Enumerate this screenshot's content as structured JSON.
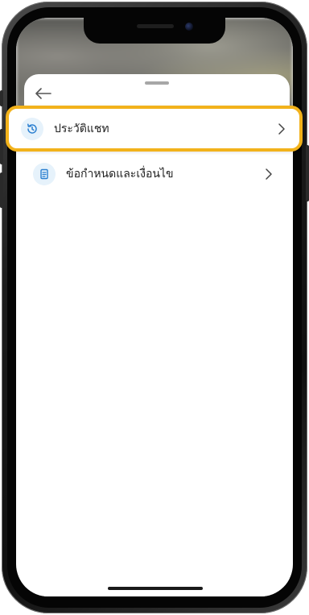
{
  "sheet": {
    "items": [
      {
        "label": "ประวัติแชท",
        "icon": "history-icon"
      },
      {
        "label": "ข้อกำหนดและเงื่อนไข",
        "icon": "document-icon"
      }
    ]
  },
  "colors": {
    "highlight_border": "#f2b21b",
    "icon_accent": "#2a7fd0",
    "icon_bg": "#e6f2fb"
  }
}
